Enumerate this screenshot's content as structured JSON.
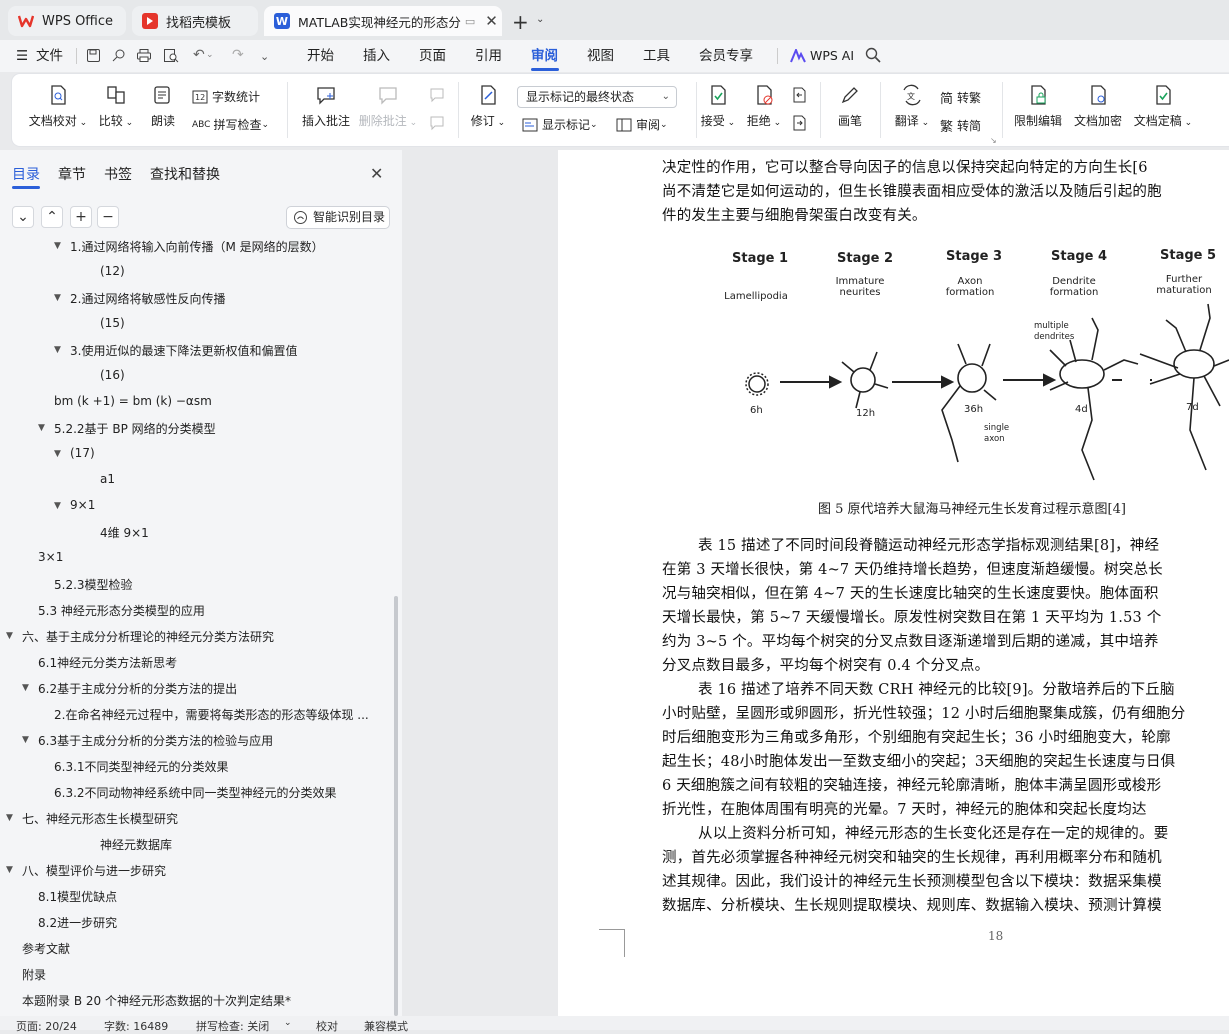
{
  "tabs": [
    {
      "label": "WPS Office"
    },
    {
      "label": "找稻壳模板"
    },
    {
      "label": "MATLAB实现神经元的形态分"
    }
  ],
  "menu": {
    "file": "文件",
    "items": [
      "开始",
      "插入",
      "页面",
      "引用",
      "审阅",
      "视图",
      "工具",
      "会员专享"
    ],
    "active": "审阅",
    "wps_ai": "WPS AI"
  },
  "ribbon": {
    "doc_check": "文档校对",
    "compare": "比较",
    "read_aloud": "朗读",
    "word_count": "字数统计",
    "spell_check": "拼写检查",
    "insert_comment": "插入批注",
    "delete_comment": "删除批注",
    "revise": "修订",
    "markup_select": "显示标记的最终状态",
    "show_markup": "显示标记",
    "review": "审阅",
    "accept": "接受",
    "reject": "拒绝",
    "brush": "画笔",
    "translate": "翻译",
    "to_traditional": "转繁",
    "to_simplified": "转简",
    "restrict_edit": "限制编辑",
    "doc_encrypt": "文档加密",
    "doc_final": "文档定稿",
    "trad_glyph": "简",
    "simp_glyph": "繁"
  },
  "nav": {
    "tabs": [
      "目录",
      "章节",
      "书签",
      "查找和替换"
    ],
    "active_tab": "目录",
    "smart_toc": "智能识别目录",
    "items": [
      {
        "text": "1.通过网络将输入向前传播（M 是网络的层数）",
        "level": 3,
        "expand": true
      },
      {
        "text": "(12)",
        "level": 4,
        "expand": false
      },
      {
        "text": "2.通过网络将敏感性反向传播",
        "level": 3,
        "expand": true
      },
      {
        "text": "(15)",
        "level": 4,
        "expand": false
      },
      {
        "text": "3.使用近似的最速下降法更新权值和偏置值",
        "level": 3,
        "expand": true
      },
      {
        "text": "(16)",
        "level": 4,
        "expand": false
      },
      {
        "text": "bm (k +1) = bm (k) −αsm",
        "level": 2,
        "expand": false
      },
      {
        "text": "5.2.2基于 BP 网络的分类模型",
        "level": 2,
        "expand": true
      },
      {
        "text": "(17)",
        "level": 3,
        "expand": true
      },
      {
        "text": "a1",
        "level": 4,
        "expand": false
      },
      {
        "text": "9×1",
        "level": 3,
        "expand": true
      },
      {
        "text": "4维 9×1",
        "level": 4,
        "expand": false
      },
      {
        "text": "3×1",
        "level": 1,
        "expand": false
      },
      {
        "text": "5.2.3模型检验",
        "level": 2,
        "expand": false
      },
      {
        "text": "5.3 神经元形态分类模型的应用",
        "level": 1,
        "expand": false
      },
      {
        "text": "六、基于主成分分析理论的神经元分类方法研究",
        "level": 0,
        "expand": true
      },
      {
        "text": "6.1神经元分类方法新思考",
        "level": 1,
        "expand": false
      },
      {
        "text": "6.2基于主成分分析的分类方法的提出",
        "level": 1,
        "expand": true
      },
      {
        "text": "2.在命名神经元过程中，需要将每类形态的形态等级体现 ...",
        "level": 2,
        "expand": false
      },
      {
        "text": "6.3基于主成分分析的分类方法的检验与应用",
        "level": 1,
        "expand": true
      },
      {
        "text": "6.3.1不同类型神经元的分类效果",
        "level": 2,
        "expand": false
      },
      {
        "text": "6.3.2不同动物神经系统中同一类型神经元的分类效果",
        "level": 2,
        "expand": false
      },
      {
        "text": "七、神经元形态生长模型研究",
        "level": 0,
        "expand": true
      },
      {
        "text": "神经元数据库",
        "level": 4,
        "expand": false
      },
      {
        "text": "八、模型评价与进一步研究",
        "level": 0,
        "expand": true
      },
      {
        "text": "8.1模型优缺点",
        "level": 1,
        "expand": false
      },
      {
        "text": "8.2进一步研究",
        "level": 1,
        "expand": false
      },
      {
        "text": "参考文献",
        "level": 0,
        "expand": false
      },
      {
        "text": "附录",
        "level": 0,
        "expand": false
      },
      {
        "text": "本题附录 B 20 个神经元形态数据的十次判定结果*",
        "level": 0,
        "expand": false
      }
    ]
  },
  "document": {
    "top_paragraph": [
      "决定性的作用，它可以整合导向因子的信息以保持突起向特定的方向生长[6",
      "尚不清楚它是如何运动的，但生长锥膜表面相应受体的激活以及随后引起的胞",
      "件的发生主要与细胞骨架蛋白改变有关。"
    ],
    "figure": {
      "stages": [
        "Stage 1",
        "Stage 2",
        "Stage 3",
        "Stage 4",
        "Stage 5"
      ],
      "stage_desc": [
        "Lamellipodia",
        "Immature\nneurites",
        "Axon\nformation",
        "Dendrite\nformation",
        "Further\nmaturation"
      ],
      "times": [
        "6h",
        "12h",
        "36h",
        "4d",
        "7d"
      ],
      "labels": {
        "multiple_dendrites": "multiple\ndendrites",
        "single_axon": "single\naxon"
      },
      "caption": "图 5  原代培养大鼠海马神经元生长发育过程示意图[4]"
    },
    "body_paragraphs": [
      "表 15 描述了不同时间段脊髓运动神经元形态学指标观测结果[8]，神经",
      "在第 3 天增长很快，第 4~7 天仍维持增长趋势，但速度渐趋缓慢。树突总长",
      "况与轴突相似，但在第 4~7 天的生长速度比轴突的生长速度要快。胞体面积",
      "天增长最快，第 5~7 天缓慢增长。原发性树突数目在第 1 天平均为 1.53 个",
      "约为 3~5 个。平均每个树突的分叉点数目逐渐递增到后期的递减，其中培养",
      "分叉点数目最多，平均每个树突有 0.4 个分叉点。",
      "表 16 描述了培养不同天数 CRH 神经元的比较[9]。分散培养后的下丘脑",
      "小时贴壁，呈圆形或卵圆形，折光性较强；12 小时后细胞聚集成簇，仍有细胞分",
      "时后细胞变形为三角或多角形，个别细胞有突起生长；36 小时细胞变大，轮廓",
      "起生长；48小时胞体发出一至数支细小的突起；3天细胞的突起生长速度与日俱",
      "6 天细胞簇之间有较粗的突轴连接，神经元轮廓清晰，胞体丰满呈圆形或梭形",
      "折光性，在胞体周围有明亮的光晕。7 天时，神经元的胞体和突起长度均达",
      "从以上资料分析可知，神经元形态的生长变化还是存在一定的规律的。要",
      "测，首先必须掌握各种神经元树突和轴突的生长规律，再利用概率分布和随机",
      "述其规律。因此，我们设计的神经元生长预测模型包含以下模块：数据采集模",
      "数据库、分析模块、生长规则提取模块、规则库、数据输入模块、预测计算模"
    ],
    "page_number": "18"
  },
  "status": {
    "page": "页面: 20/24",
    "words": "字数: 16489",
    "spell": "拼写检查: 关闭",
    "proof": "校对",
    "compat": "兼容模式"
  },
  "colors": {
    "accent": "#2b5fd9",
    "wps_red": "#e5352b"
  }
}
